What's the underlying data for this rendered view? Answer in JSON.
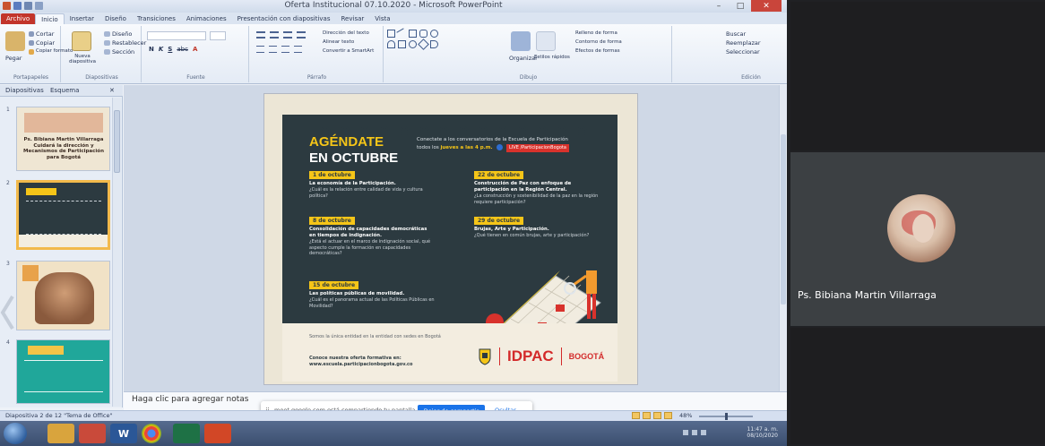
{
  "window": {
    "title": "Oferta Institucional 07.10.2020 - Microsoft PowerPoint",
    "minimize": "–",
    "maximize": "□",
    "close": "✕"
  },
  "ribbon": {
    "tabs": [
      "Archivo",
      "Inicio",
      "Insertar",
      "Diseño",
      "Transiciones",
      "Animaciones",
      "Presentación con diapositivas",
      "Revisar",
      "Vista"
    ],
    "active_tab": "Inicio",
    "clipboard": {
      "paste": "Pegar",
      "cut": "Cortar",
      "copy": "Copiar",
      "format_painter": "Copiar formato",
      "label": "Portapapeles"
    },
    "slides": {
      "new_slide": "Nueva diapositiva",
      "layout": "Diseño",
      "reset": "Restablecer",
      "section": "Sección",
      "label": "Diapositivas"
    },
    "font": {
      "label": "Fuente",
      "bold": "N",
      "italic": "K",
      "underline": "S",
      "shadow": "abc"
    },
    "paragraph": {
      "direction": "Dirección del texto",
      "align": "Alinear texto",
      "smartart": "Convertir a SmartArt",
      "label": "Párrafo"
    },
    "drawing": {
      "arrange": "Organizar",
      "styles": "Estilos rápidos",
      "fill": "Relleno de forma",
      "outline": "Contorno de forma",
      "effects": "Efectos de formas",
      "label": "Dibujo"
    },
    "editing": {
      "find": "Buscar",
      "replace": "Reemplazar",
      "select": "Seleccionar",
      "label": "Edición"
    }
  },
  "panel": {
    "tabs": [
      "Diapositivas",
      "Esquema"
    ],
    "thumbs": [
      {
        "num": "1",
        "text": "Ps. Bibiana Martin Villarraga Cuidará la dirección y Mecanismos de Participación para Bogotá"
      },
      {
        "num": "2",
        "text": ""
      },
      {
        "num": "3",
        "text": ""
      },
      {
        "num": "4",
        "text": ""
      }
    ]
  },
  "slide": {
    "headline_1": "AGÉNDATE",
    "headline_2": "EN OCTUBRE",
    "invite_1": "Conectate a los conversatorios de la Escuela de Participación",
    "invite_2a": "todos los",
    "invite_2b": "jueves a las 4 p.m.",
    "live": "LIVE /ParticipacionBogota",
    "events": [
      {
        "date": "1 de octubre",
        "title": "La economía de la Participación.",
        "desc": "¿Cuál es la relación entre calidad de vida y cultura política?"
      },
      {
        "date": "8 de octubre",
        "title": "Consolidación de capacidades democráticas en tiempos de indignación.",
        "desc": "¿Está el actuar en el marco de indignación social, qué aspecto cumple la formación en capacidades democráticas?"
      },
      {
        "date": "15 de octubre",
        "title": "Las políticas públicas de movilidad.",
        "desc": "¿Cuál es el panorama actual de las Políticas Públicas en Movilidad?"
      },
      {
        "date": "22 de octubre",
        "title": "Construcción de Paz con enfoque de participación en la Región Central.",
        "desc": "¿La construcción y sostenibilidad de la paz en la región requiere participación?"
      },
      {
        "date": "29 de octubre",
        "title": "Brujas, Arte y Participación.",
        "desc": "¿Qué tienen en común brujas, arte y participación?"
      }
    ],
    "footer_1": "Somos la única entidad en la entidad con sedes en Bogotá",
    "footer_2": "Conoce nuestra oferta formativa en: www.escuela.participacionbogota.gov.co",
    "logo_idpac": "IDPAC",
    "logo_bogota": "BOGOTÁ"
  },
  "notes": {
    "placeholder": "Haga clic para agregar notas"
  },
  "share_banner": {
    "message": "meet.google.com está compartiendo tu pantalla.",
    "stop": "Dejar de compartir",
    "hide": "Ocultar"
  },
  "statusbar": {
    "slide_info": "Diapositiva 2 de 12   \"Tema de Office\"",
    "zoom": "48%"
  },
  "tray": {
    "time": "11:47 a. m.",
    "date": "08/10/2020"
  },
  "meet": {
    "participant_name": "Ps. Bibiana Martin Villarraga"
  },
  "colors": {
    "accent_yellow": "#f5c518",
    "poster_dark": "#2c3a40",
    "idpac_red": "#d32a2a",
    "meet_blue": "#1a73e8"
  }
}
